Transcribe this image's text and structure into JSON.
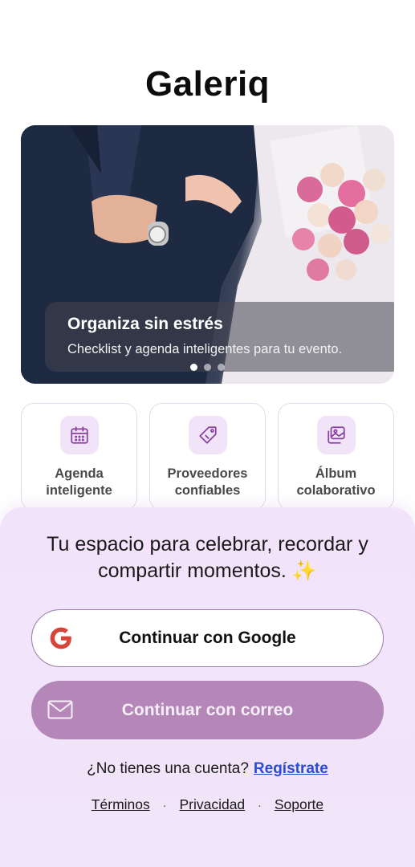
{
  "app": {
    "title": "Galeriq"
  },
  "hero": {
    "title": "Organiza sin estrés",
    "subtitle": "Checklist y agenda inteligentes para tu evento.",
    "slides": 3,
    "active_slide": 1
  },
  "features": [
    {
      "label": "Agenda\ninteligente",
      "icon": "calendar-icon"
    },
    {
      "label": "Proveedores\nconfiables",
      "icon": "tag-icon"
    },
    {
      "label": "Álbum\ncolaborativo",
      "icon": "photo-album-icon"
    }
  ],
  "auth": {
    "tagline": "Tu espacio para celebrar, recordar y compartir momentos. ✨",
    "google_label": "Continuar con Google",
    "email_label": "Continuar con correo",
    "signup_prompt": "¿No tienes una cuenta?",
    "signup_link": "Regístrate"
  },
  "footer": {
    "terms": "Términos",
    "privacy": "Privacidad",
    "support": "Soporte",
    "separator": "·"
  },
  "colors": {
    "accent": "#b487b8",
    "icon_bg": "#f1e3f8",
    "icon_stroke": "#8a3fa0",
    "link": "#2a4ad8",
    "sheet": "#f2e3fa"
  }
}
